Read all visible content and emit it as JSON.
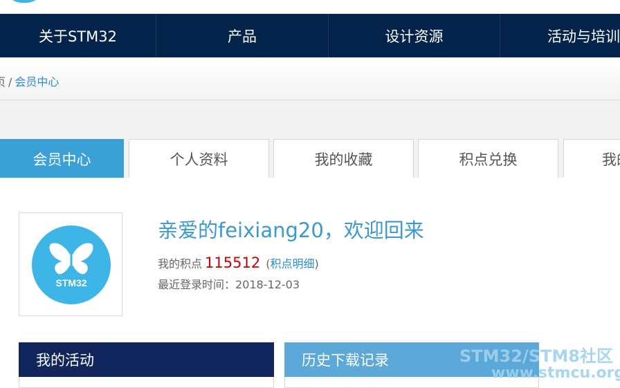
{
  "nav": {
    "items": [
      {
        "label": "关于STM32"
      },
      {
        "label": "产品"
      },
      {
        "label": "设计资源"
      },
      {
        "label": "活动与培训"
      }
    ]
  },
  "breadcrumb": {
    "home": "页",
    "separator": "/",
    "current": "会员中心"
  },
  "tabs": [
    {
      "label": "会员中心",
      "active": true
    },
    {
      "label": "个人资料",
      "active": false
    },
    {
      "label": "我的收藏",
      "active": false
    },
    {
      "label": "积点兑换",
      "active": false
    },
    {
      "label": "我的",
      "active": false
    }
  ],
  "profile": {
    "avatar_text": "STM32",
    "welcome": "亲爱的feixiang20，欢迎回来",
    "points_label": "我的积点",
    "points_value": "115512",
    "points_detail_open": "(",
    "points_detail_link": "积点明细",
    "points_detail_close": ")",
    "last_login_label": "最近登录时间：",
    "last_login_date": "2018-12-03"
  },
  "panels": {
    "activities_title": "我的活动",
    "downloads_title": "历史下载记录"
  },
  "watermark": {
    "line1": "STM32/STM8社区",
    "line2": "www.stmcu.org.cn"
  },
  "colors": {
    "nav_bg": "#03234b",
    "tab_active": "#3aa0d6",
    "points_red": "#cc0000",
    "link_blue": "#2a8ccc",
    "logo_blue": "#3db5e6"
  }
}
